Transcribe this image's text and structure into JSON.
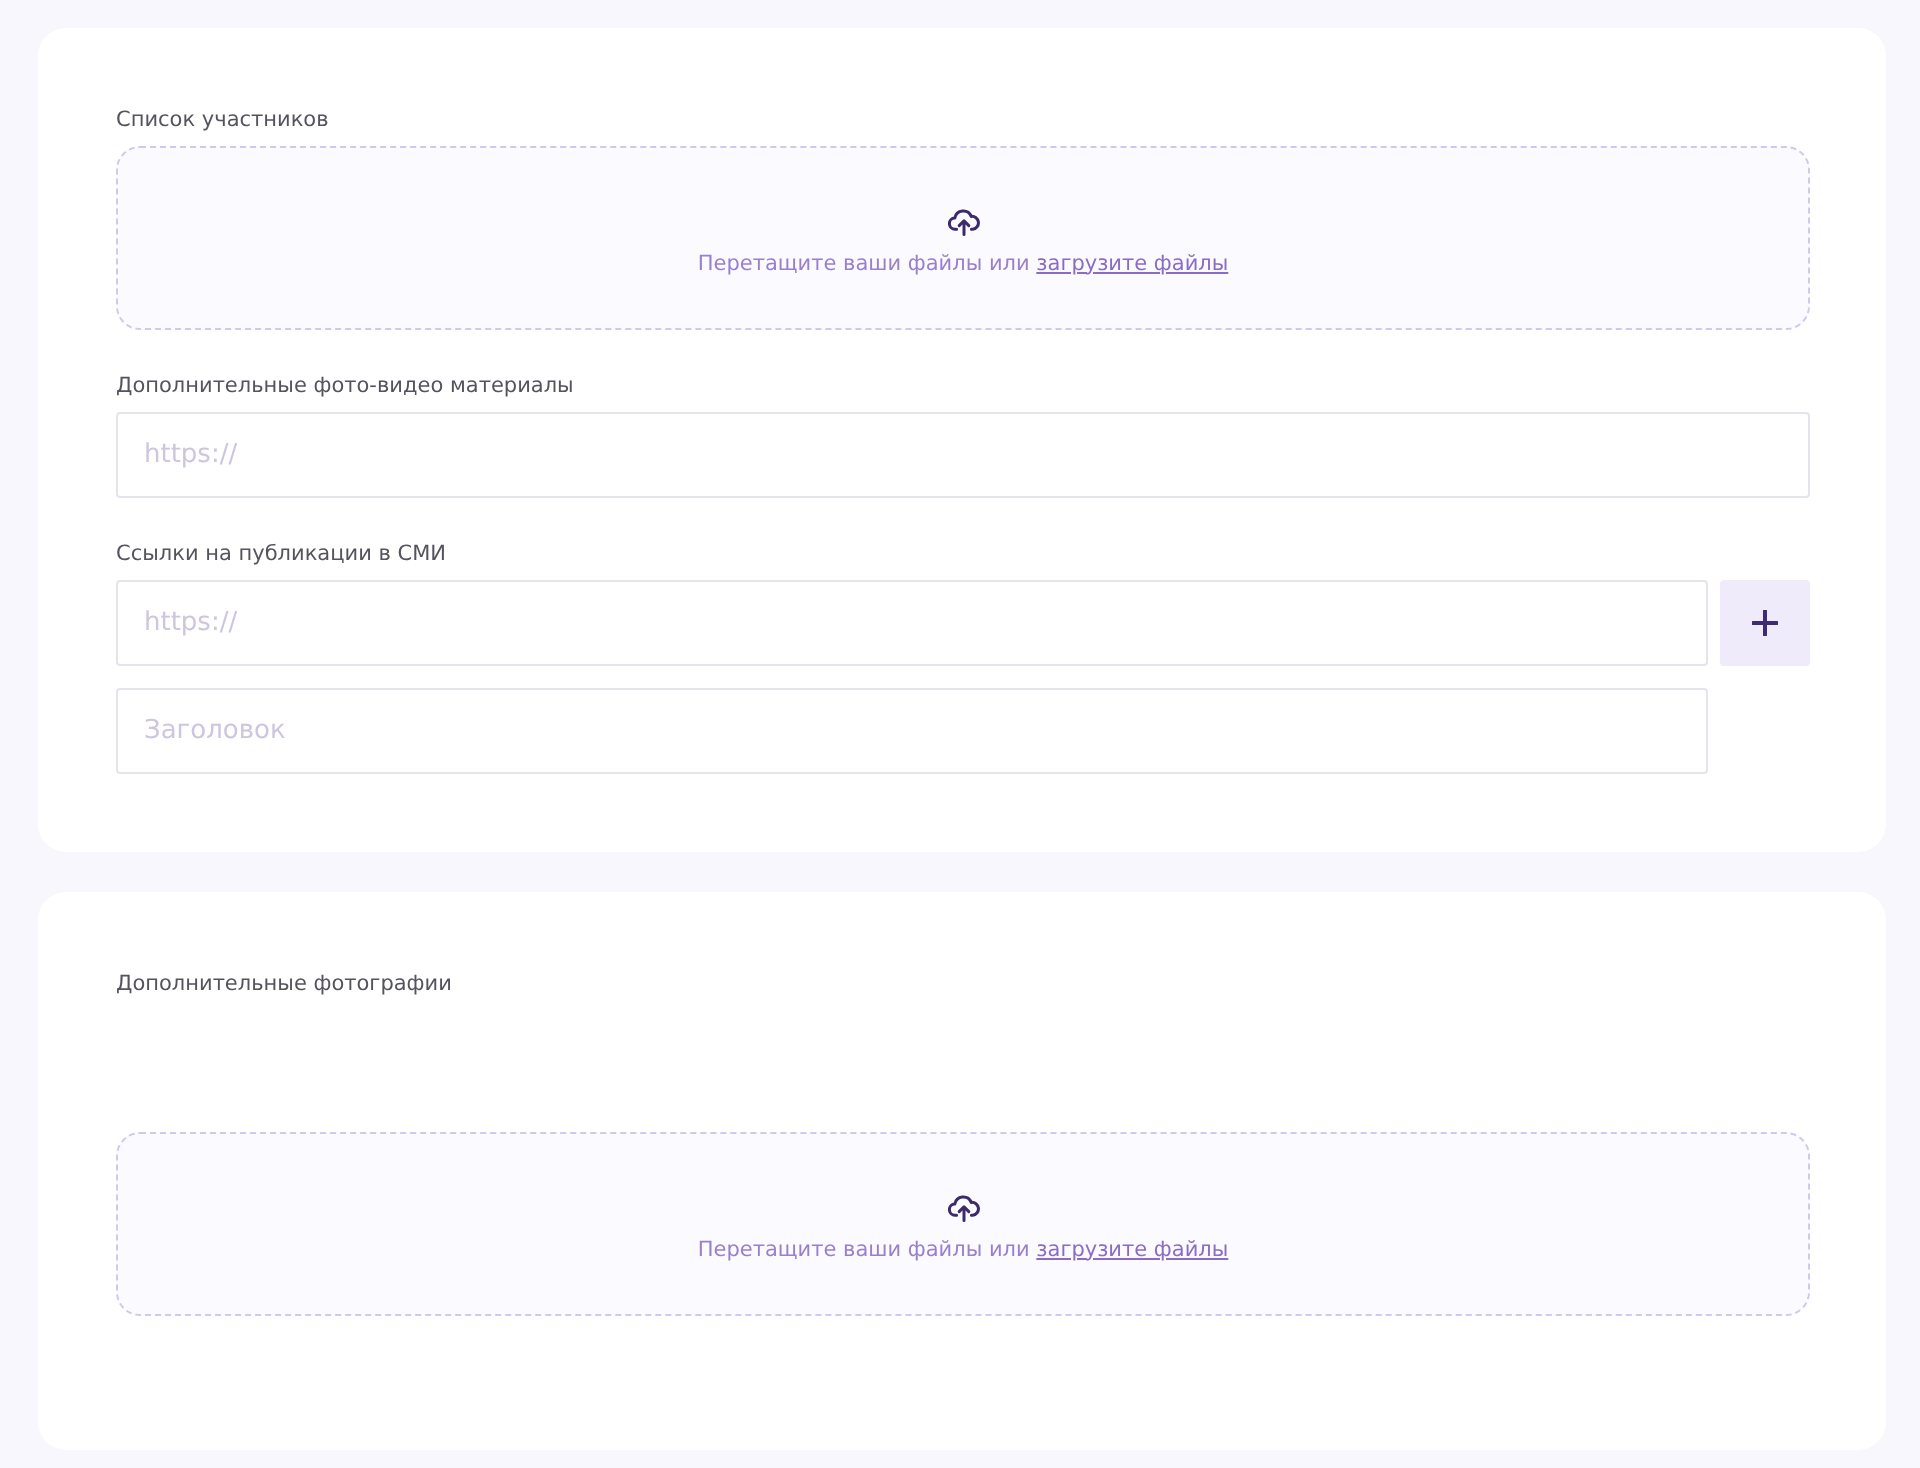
{
  "sections": [
    {
      "fields": [
        {
          "kind": "dropzone",
          "label": "Список участников",
          "prompt": "Перетащите ваши файлы или",
          "link": "загрузите файлы"
        },
        {
          "kind": "inputs",
          "label": "Дополнительные фото-видео материалы",
          "inputs": [
            {
              "placeholder": "https://",
              "add_button": false
            }
          ]
        },
        {
          "kind": "inputs",
          "label": "Ссылки на публикации в СМИ",
          "inputs": [
            {
              "placeholder": "https://",
              "add_button": true
            },
            {
              "placeholder": "Заголовок",
              "add_button": false
            }
          ]
        }
      ]
    },
    {
      "fields": [
        {
          "kind": "dropzone",
          "label": "Дополнительные фотографии",
          "prompt": "Перетащите ваши файлы или",
          "link": "загрузите файлы"
        }
      ]
    }
  ]
}
